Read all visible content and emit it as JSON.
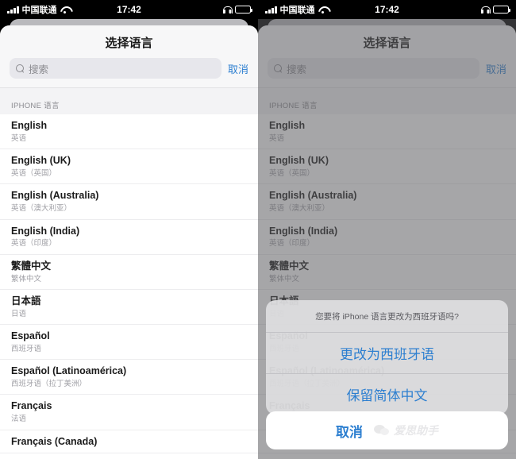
{
  "status_bar": {
    "carrier": "中国联通",
    "time": "17:42",
    "signal_icon": "signal-bars-icon",
    "wifi_icon": "wifi-icon",
    "headphone_icon": "headphone-icon",
    "battery_icon": "battery-icon",
    "battery_level_percent": 42
  },
  "sheet": {
    "title": "选择语言",
    "search_placeholder": "搜索",
    "search_value": "",
    "search_icon": "search-icon",
    "cancel_label": "取消"
  },
  "section": {
    "header": "IPHONE 语言"
  },
  "languages": [
    {
      "name": "English",
      "sub": "英语"
    },
    {
      "name": "English (UK)",
      "sub": "英语（英国）"
    },
    {
      "name": "English (Australia)",
      "sub": "英语（澳大利亚）"
    },
    {
      "name": "English (India)",
      "sub": "英语（印度）"
    },
    {
      "name": "繁體中文",
      "sub": "繁体中文"
    },
    {
      "name": "日本語",
      "sub": "日语"
    },
    {
      "name": "Español",
      "sub": "西班牙语"
    },
    {
      "name": "Español (Latinoamérica)",
      "sub": "西班牙语（拉丁美洲）"
    },
    {
      "name": "Français",
      "sub": "法语"
    },
    {
      "name": "Français (Canada)",
      "sub": ""
    }
  ],
  "action_sheet": {
    "message": "您要将 iPhone 语言更改为西班牙语吗?",
    "change_label": "更改为西班牙语",
    "keep_label": "保留简体中文",
    "cancel_label": "取消"
  },
  "watermark": {
    "text": "爱思助手",
    "logo_icon": "wechat-logo-icon"
  },
  "colors": {
    "accent_blue": "#2d7fd0",
    "status_bar_bg": "#000000",
    "card_bg": "#ffffff",
    "section_bg": "#f3f3f5",
    "dim_overlay": "rgba(92,92,96,0.55)"
  }
}
